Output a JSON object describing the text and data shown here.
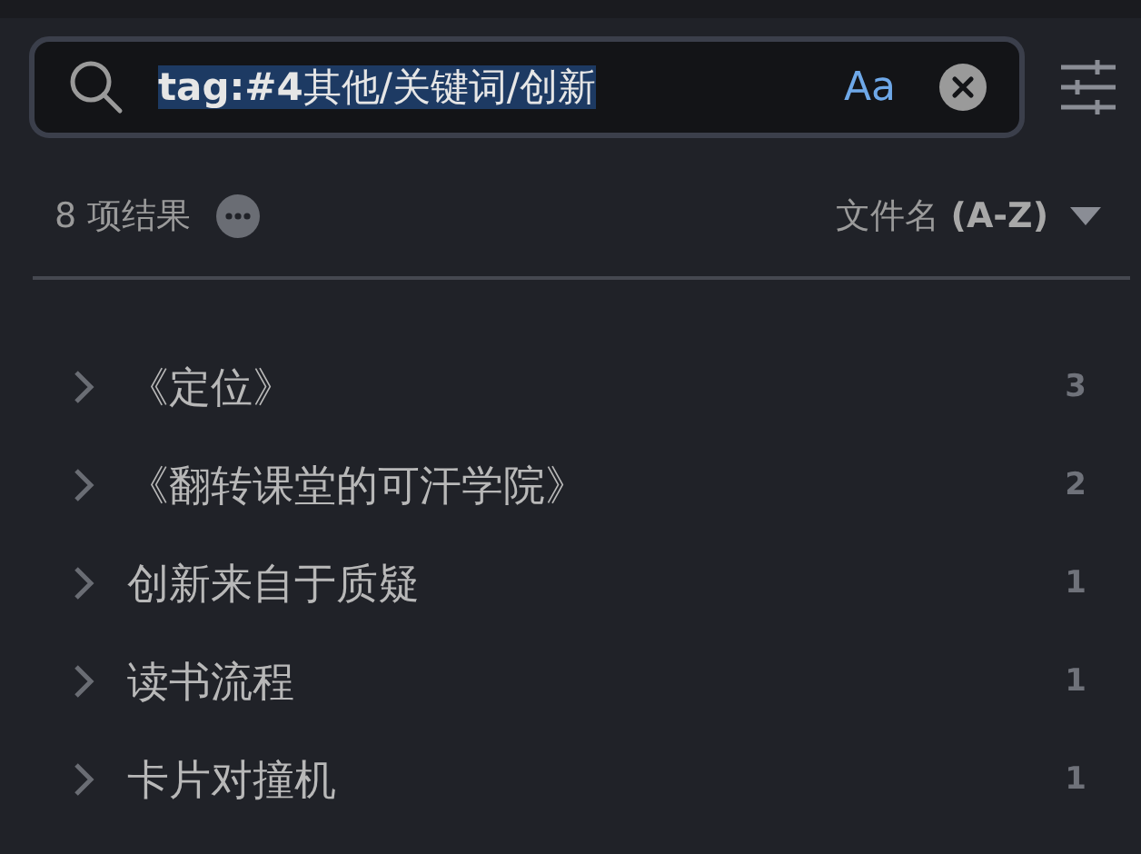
{
  "search": {
    "value": "**tag:#4**其他/关键词/创新",
    "text_selected": true,
    "match_case": {
      "label": "Aa",
      "on": true
    }
  },
  "summary": {
    "count": "8 项结果",
    "sort": "文件名 **(A-Z)**"
  },
  "results": [
    {
      "title": "《定位》",
      "count": "3",
      "expanded": false
    },
    {
      "title": "《翻转课堂的可汗学院》",
      "count": "2",
      "expanded": false
    },
    {
      "title": "创新来自于质疑",
      "count": "1",
      "expanded": false
    },
    {
      "title": "读书流程",
      "count": "1",
      "expanded": false
    },
    {
      "title": "卡片对撞机",
      "count": "1",
      "expanded": false
    }
  ]
}
